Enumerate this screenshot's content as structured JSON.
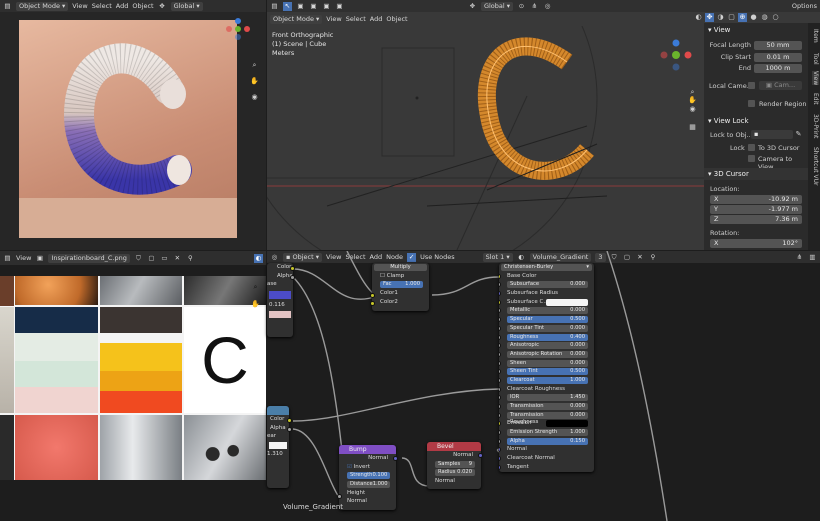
{
  "top_left": {
    "mode": "Object Mode",
    "menus": [
      "View",
      "Select",
      "Add",
      "Object"
    ],
    "orientation": "Global"
  },
  "viewport": {
    "mode": "Object Mode",
    "menus": [
      "View",
      "Select",
      "Add",
      "Object"
    ],
    "orientation": "Global",
    "options": "Options",
    "info_line1": "Front Orthographic",
    "info_line2": "(1) Scene | Cube",
    "info_line3": "Meters"
  },
  "n_panel": {
    "tabs": [
      "Item",
      "Tool",
      "View",
      "Edit",
      "3D-Print",
      "Shortcut VUr"
    ],
    "view_header": "View",
    "focal_length_label": "Focal Length",
    "focal_length": "50 mm",
    "clip_start_label": "Clip Start",
    "clip_start": "0.01 m",
    "end_label": "End",
    "end": "1000 m",
    "local_camera_label": "Local Came...",
    "local_camera_value": "Cam...",
    "render_region": "Render Region",
    "view_lock_header": "View Lock",
    "lock_to_object_label": "Lock to Obj...",
    "lock_label": "Lock",
    "to_3d_cursor": "To 3D Cursor",
    "camera_to_view": "Camera to View",
    "cursor_header": "3D Cursor",
    "location_label": "Location:",
    "x_label": "X",
    "x_value": "-10.92 m",
    "y_label": "Y",
    "y_value": "-1.977 m",
    "z_label": "Z",
    "z_value": "7.36 m",
    "rotation_label": "Rotation:",
    "rx_label": "X",
    "rx_value": "102°"
  },
  "image_editor": {
    "menu": "View",
    "image_name": "Inspirationboard_C.png",
    "letter": "C"
  },
  "node_editor": {
    "object_label": "Object",
    "menus": [
      "View",
      "Select",
      "Add",
      "Node"
    ],
    "use_nodes": "Use Nodes",
    "slot": "Slot 1",
    "material": "Volume_Gradient",
    "users": "3",
    "material_label_bottom": "Volume_Gradient",
    "left_node_outputs": [
      "Color",
      "Alpha"
    ],
    "left_node_field1": "ase",
    "left_node_value": "0.116",
    "left_node2_outputs": [
      "Color",
      "Alpha"
    ],
    "left_node2_field": "ear",
    "left_node2_value": "1.310",
    "mix": {
      "blend": "Multiply",
      "clamp": "Clamp",
      "fac_label": "Fac",
      "fac_value": "1.000",
      "color1": "Color1",
      "color2": "Color2"
    },
    "bump": {
      "title": "Bump",
      "normal_out": "Normal",
      "invert": "Invert",
      "strength_label": "Strength",
      "strength_value": "0.100",
      "distance_label": "Distance",
      "distance_value": "1.000",
      "height": "Height",
      "normal_in": "Normal"
    },
    "bevel": {
      "title": "Bevel",
      "normal_out": "Normal",
      "samples_label": "Samples",
      "samples_value": "9",
      "radius_label": "Radius",
      "radius_value": "0.020",
      "normal_in": "Normal"
    },
    "principled": {
      "method": "Christensen-Burley",
      "rows": [
        {
          "label": "Base Color",
          "value": "",
          "kind": "label"
        },
        {
          "label": "Subsurface",
          "value": "0.000",
          "kind": "field"
        },
        {
          "label": "Subsurface Radius",
          "value": "",
          "kind": "label"
        },
        {
          "label": "Subsurface C...",
          "value": "",
          "kind": "swatch"
        },
        {
          "label": "Metallic",
          "value": "0.000",
          "kind": "field"
        },
        {
          "label": "Specular",
          "value": "0.500",
          "kind": "blue"
        },
        {
          "label": "Specular Tint",
          "value": "0.000",
          "kind": "field"
        },
        {
          "label": "Roughness",
          "value": "0.400",
          "kind": "blue"
        },
        {
          "label": "Anisotropic",
          "value": "0.000",
          "kind": "field"
        },
        {
          "label": "Anisotropic Rotation",
          "value": "0.000",
          "kind": "field"
        },
        {
          "label": "Sheen",
          "value": "0.000",
          "kind": "field"
        },
        {
          "label": "Sheen Tint",
          "value": "0.500",
          "kind": "blue"
        },
        {
          "label": "Clearcoat",
          "value": "1.000",
          "kind": "blue"
        },
        {
          "label": "Clearcoat Roughness",
          "value": "",
          "kind": "label"
        },
        {
          "label": "IOR",
          "value": "1.450",
          "kind": "field"
        },
        {
          "label": "Transmission",
          "value": "0.000",
          "kind": "field"
        },
        {
          "label": "Transmission Roughness",
          "value": "0.000",
          "kind": "field"
        },
        {
          "label": "Emission",
          "value": "",
          "kind": "black"
        },
        {
          "label": "Emission Strength",
          "value": "1.000",
          "kind": "field"
        },
        {
          "label": "Alpha",
          "value": "0.150",
          "kind": "blue"
        },
        {
          "label": "Normal",
          "value": "",
          "kind": "label"
        },
        {
          "label": "Clearcoat Normal",
          "value": "",
          "kind": "label"
        },
        {
          "label": "Tangent",
          "value": "",
          "kind": "label"
        }
      ]
    }
  },
  "colors": {
    "accent": "#4772b3",
    "wire_orange": "#f0962a",
    "bump_header": "#7f4ec4",
    "bevel_header": "#b13a45"
  }
}
